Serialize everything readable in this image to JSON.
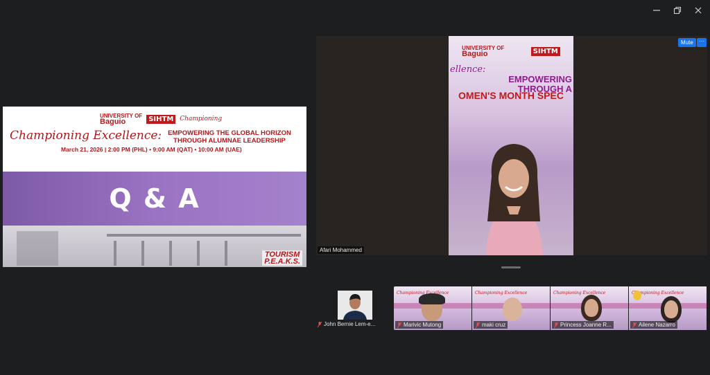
{
  "window": {
    "controls": [
      "minimize-icon",
      "restore-icon",
      "close-icon"
    ]
  },
  "shared_screen": {
    "logos": {
      "university_small": "UNIVERSITY OF",
      "university_big": "Baguio",
      "sihtm": "SIHTM",
      "script_logo": "Championing"
    },
    "title_script": "Championing Excellence:",
    "title_bold_line1": "EMPOWERING THE GLOBAL HORIZON",
    "title_bold_line2": "THROUGH ALUMNAE LEADERSHIP",
    "date_line": "March 21, 2026 | 2:00 PM (PHL) • 9:00 AM (QAT) • 10:00 AM (UAE)",
    "band_text": "Q & A",
    "corner_line1": "TOURISM",
    "corner_line2": "P.E.A.K.S."
  },
  "speaker": {
    "name": "Afari Mohammed",
    "backdrop": {
      "university_small": "UNIVERSITY OF",
      "university_big": "Baguio",
      "sihtm": "SIHTM",
      "line1": "ellence:",
      "line2_a": "EMPOWERING",
      "line2_b": "THROUGH A",
      "line3": "OMEN'S MONTH SPEC"
    },
    "mute_label": "Mute",
    "more_label": "···"
  },
  "participants": {
    "single": {
      "name": "John Bernie Lem-e..."
    },
    "strip": [
      {
        "name": "Marivic Mutong",
        "mic": "muted-icon"
      },
      {
        "name": "maki cruz",
        "mic": "muted-icon"
      },
      {
        "name": "Princess Joanne R...",
        "mic": "muted-icon"
      },
      {
        "name": "Ailene Nazarro",
        "mic": "muted-icon"
      }
    ]
  },
  "colors": {
    "background": "#1c1e20",
    "accent_blue": "#1a73e8",
    "brand_red": "#b3161a",
    "band_purple": "#9a73c3",
    "muted_red": "#e05050"
  }
}
